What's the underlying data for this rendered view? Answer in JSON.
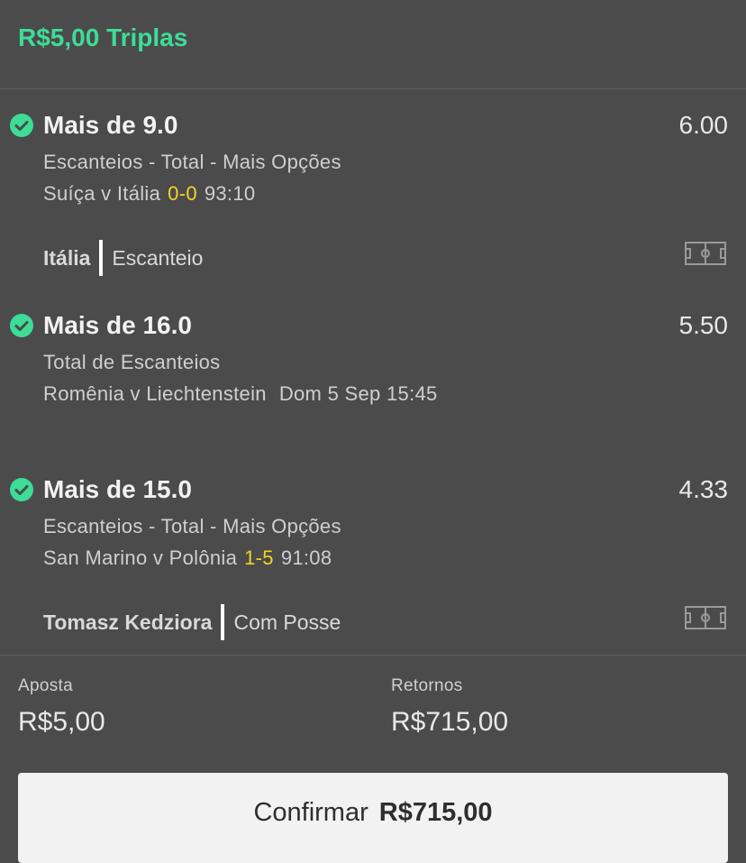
{
  "header": {
    "title": "R$5,00 Triplas"
  },
  "selections": [
    {
      "title": "Mais de 9.0",
      "odds": "6.00",
      "market": "Escanteios - Total - Mais Opções",
      "event": "Suíça v Itália",
      "score": "0-0",
      "time": "93:10",
      "stat_team": "Itália",
      "stat_desc": "Escanteio"
    },
    {
      "title": "Mais de 16.0",
      "odds": "5.50",
      "market": "Total de Escanteios",
      "event": "Romênia v Liechtenstein",
      "date": "Dom 5 Sep 15:45"
    },
    {
      "title": "Mais de 15.0",
      "odds": "4.33",
      "market": "Escanteios - Total - Mais Opções",
      "event": "San Marino v Polônia",
      "score": "1-5",
      "time": "91:08",
      "stat_team": "Tomasz Kedziora",
      "stat_desc": "Com Posse"
    }
  ],
  "summary": {
    "stake_label": "Aposta",
    "stake_value": "R$5,00",
    "returns_label": "Retornos",
    "returns_value": "R$715,00"
  },
  "confirm": {
    "label": "Confirmar",
    "amount": "R$715,00"
  },
  "colors": {
    "accent": "#3ddc97",
    "score": "#f5d327",
    "background": "#4b4b4b"
  },
  "icons": [
    "check-circle-icon",
    "pitch-icon"
  ]
}
